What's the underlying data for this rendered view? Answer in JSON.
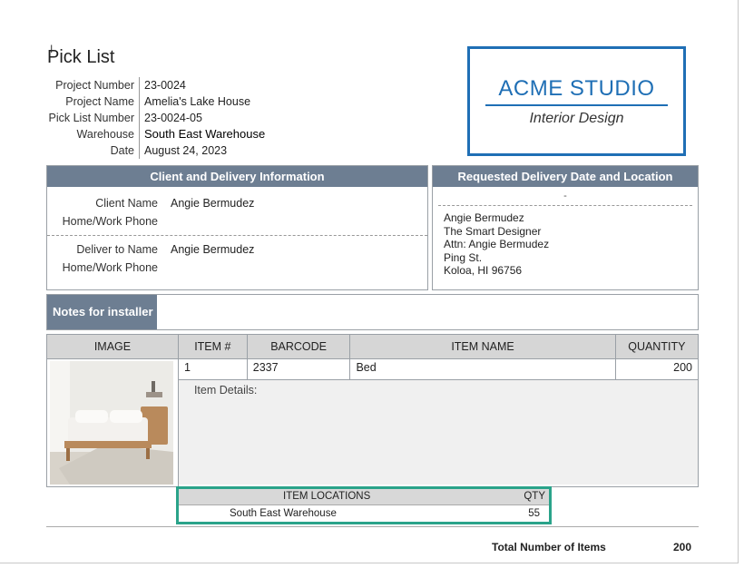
{
  "title": "Pick List",
  "project": [
    {
      "label": "Project Number",
      "value": "23-0024"
    },
    {
      "label": "Project Name",
      "value": "Amelia's Lake House"
    },
    {
      "label": "Pick List Number",
      "value": "23-0024-05"
    },
    {
      "label": "Warehouse",
      "value": "South East Warehouse"
    },
    {
      "label": "Date",
      "value": "August 24, 2023"
    }
  ],
  "logo": {
    "name": "ACME STUDIO",
    "tagline": "Interior Design",
    "color": "#1f6fb5"
  },
  "client": {
    "header": "Client and Delivery Information",
    "client_name_label": "Client Name",
    "client_name": "Angie Bermudez",
    "client_phone_label": "Home/Work Phone",
    "client_phone": "",
    "deliver_name_label": "Deliver to Name",
    "deliver_name": "Angie Bermudez",
    "deliver_phone_label": "Home/Work Phone",
    "deliver_phone": ""
  },
  "delivery": {
    "header": "Requested Delivery Date and Location",
    "date": "-",
    "address": [
      "Angie Bermudez",
      "The Smart Designer",
      "Attn: Angie Bermudez",
      "Ping St.",
      "Koloa, HI 96756"
    ]
  },
  "notes": {
    "label": "Notes for installer",
    "value": ""
  },
  "items_table": {
    "columns": [
      "IMAGE",
      "ITEM #",
      "BARCODE",
      "ITEM NAME",
      "QUANTITY"
    ],
    "rows": [
      {
        "item_no": "1",
        "barcode": "2337",
        "name": "Bed",
        "quantity": "200",
        "details_label": "Item Details:"
      }
    ]
  },
  "locations": {
    "header": "ITEM LOCATIONS",
    "qty_header": "QTY",
    "rows": [
      {
        "location": "South East Warehouse",
        "qty": "55"
      }
    ]
  },
  "total": {
    "label": "Total Number of Items",
    "value": "200"
  },
  "colors": {
    "header_bg": "#6d7e92",
    "location_border": "#2aa38a"
  }
}
